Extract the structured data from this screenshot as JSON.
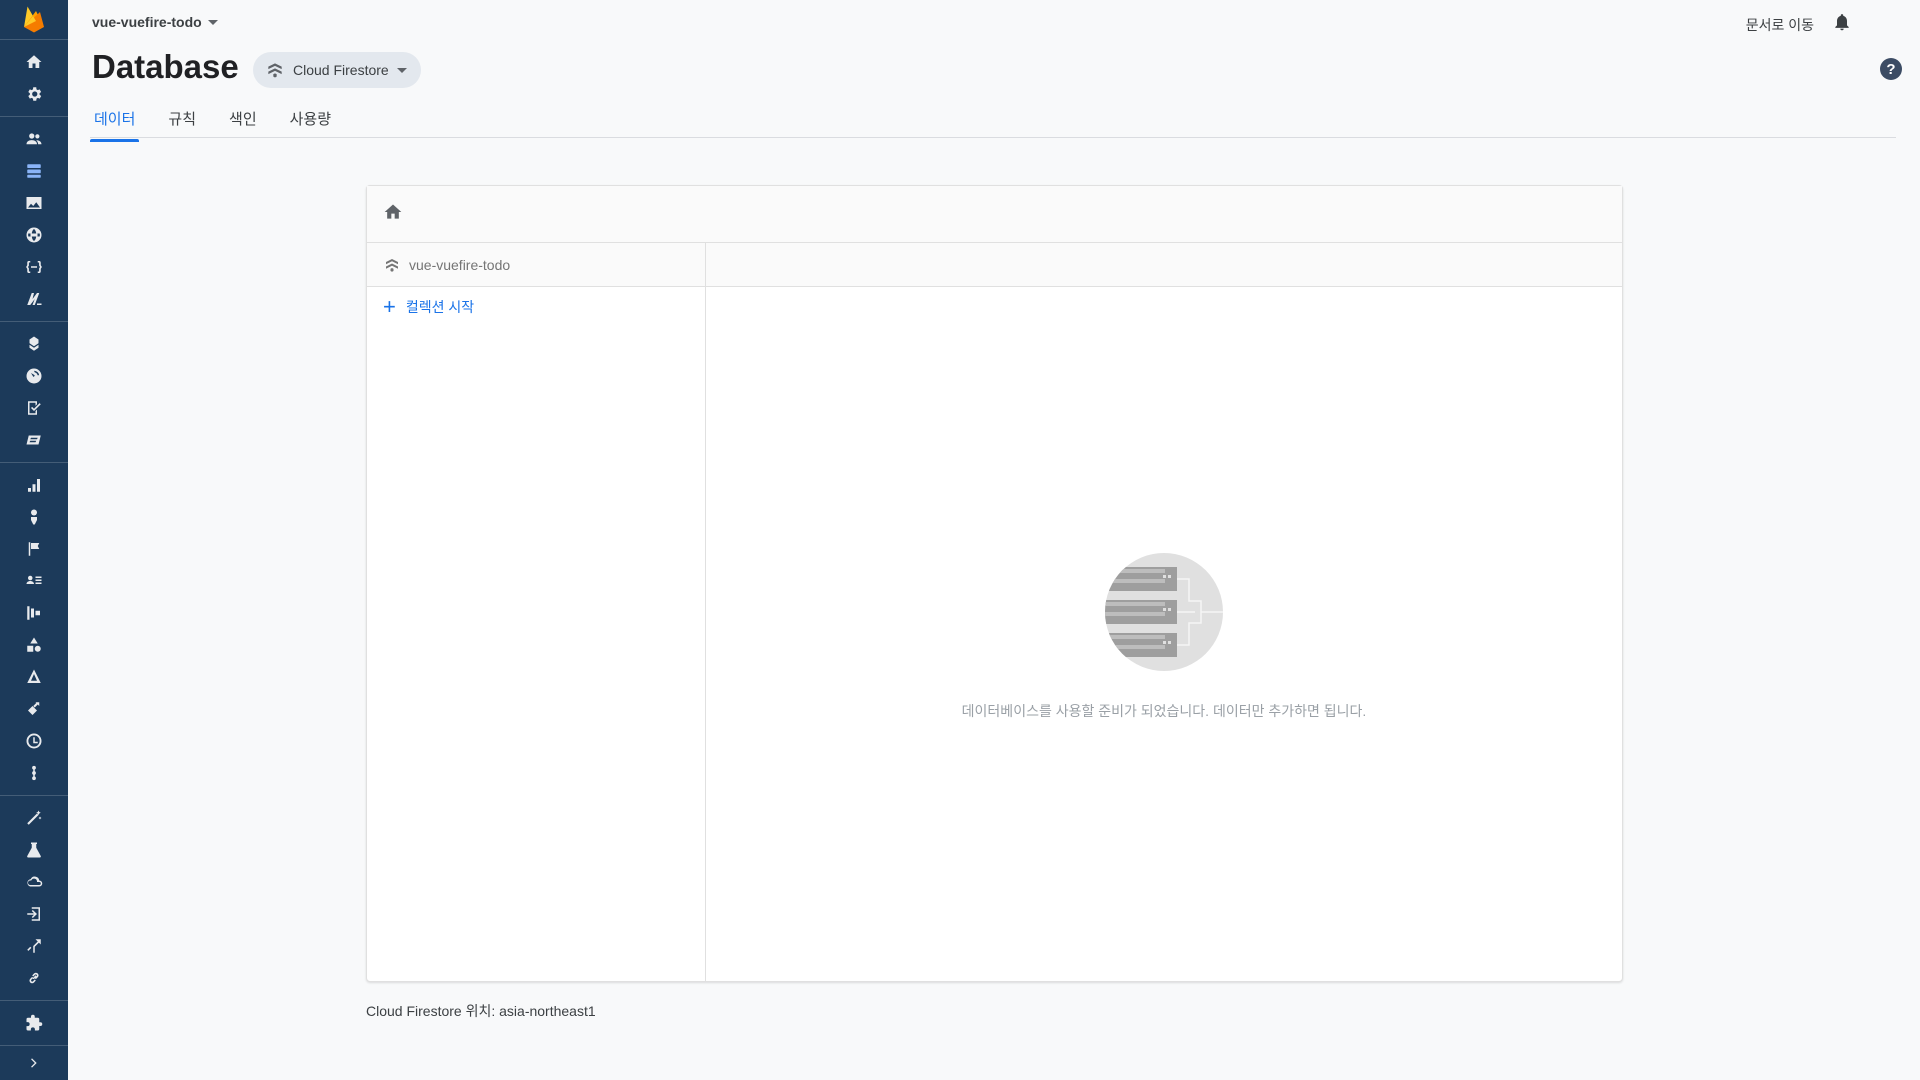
{
  "project": {
    "name": "vue-vuefire-todo"
  },
  "header": {
    "docs_link": "문서로 이동",
    "page_title": "Database",
    "db_selector": "Cloud Firestore",
    "help": "?"
  },
  "tabs": [
    {
      "label": "데이터",
      "active": true
    },
    {
      "label": "규칙",
      "active": false
    },
    {
      "label": "색인",
      "active": false
    },
    {
      "label": "사용량",
      "active": false
    }
  ],
  "panel": {
    "root_label": "vue-vuefire-todo",
    "add_collection_label": "컬렉션 시작",
    "empty_message": "데이터베이스를 사용할 준비가 되었습니다. 데이터만 추가하면 됩니다."
  },
  "footer": {
    "location": "Cloud Firestore 위치: asia-northeast1"
  },
  "rail": {
    "icons": [
      "home-icon",
      "settings-icon",
      "authentication-icon",
      "database-icon",
      "storage-icon",
      "hosting-icon",
      "functions-icon",
      "ml-kit-icon",
      "crashlytics-icon",
      "performance-icon",
      "test-lab-icon",
      "app-distribution-icon",
      "analytics-icon",
      "predictions-icon",
      "events-icon",
      "audiences-icon",
      "funnels-icon",
      "ab-testing-icon",
      "in-app-messaging-icon",
      "remote-config-icon",
      "dynamic-links-icon",
      "cloud-messaging-icon",
      "extensions-icon",
      "lab-icon",
      "cloud-icon",
      "login-icon",
      "reroute-icon",
      "link-icon",
      "puzzle-icon"
    ],
    "expand_icon": "chevron-right-icon",
    "accent": "#8ab4f8",
    "background": "#1c3a5a"
  },
  "colors": {
    "primary": "#1a73e8",
    "muted": "#9aa0a6"
  }
}
